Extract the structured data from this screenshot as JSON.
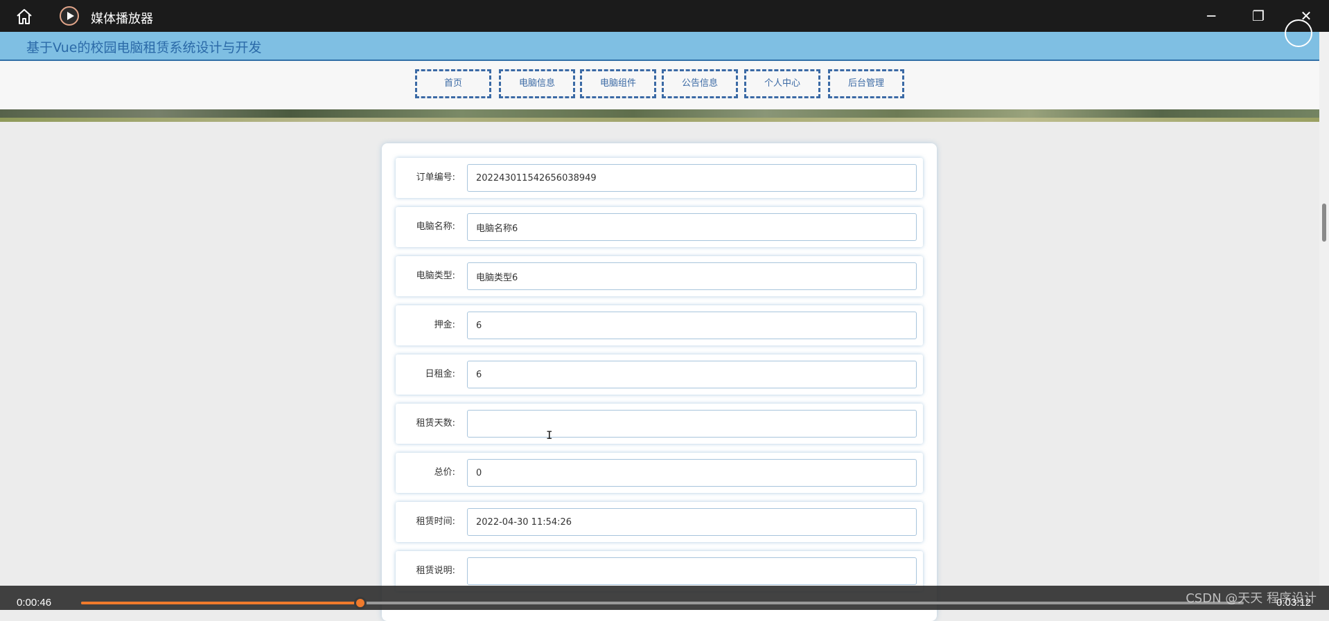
{
  "player": {
    "title": "媒体播放器",
    "icons": {
      "home": "home-icon",
      "logo": "play-logo-icon",
      "minimize": "minimize-icon",
      "restore": "restore-icon",
      "close": "close-icon"
    },
    "current_time": "0:00:46",
    "total_time": "0:03:12",
    "progress": 0.24,
    "accent_color": "#f07a2c"
  },
  "site": {
    "title": "基于Vue的校园电脑租赁系统设计与开发",
    "nav": [
      "首页",
      "电脑信息",
      "电脑组件",
      "公告信息",
      "个人中心",
      "后台管理"
    ]
  },
  "form": {
    "fields": [
      {
        "label": "订单编号:",
        "value": "202243011542656038949"
      },
      {
        "label": "电脑名称:",
        "value": "电脑名称6"
      },
      {
        "label": "电脑类型:",
        "value": "电脑类型6"
      },
      {
        "label": "押金:",
        "value": "6"
      },
      {
        "label": "日租金:",
        "value": "6"
      },
      {
        "label": "租赁天数:",
        "value": ""
      },
      {
        "label": "总价:",
        "value": "0"
      },
      {
        "label": "租赁时间:",
        "value": "2022-04-30 11:54:26"
      },
      {
        "label": "租赁说明:",
        "value": ""
      }
    ]
  },
  "watermark": "CSDN @天天 程序设计"
}
